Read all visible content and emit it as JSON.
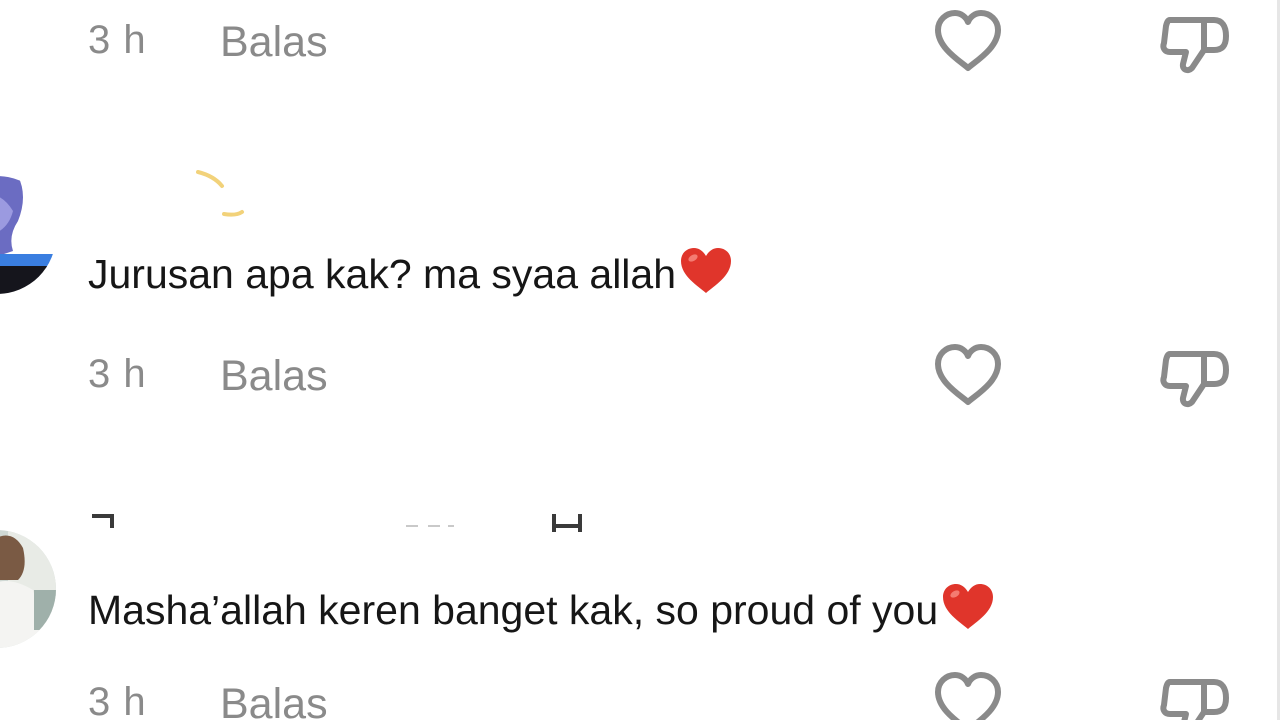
{
  "comments": [
    {
      "text": "",
      "time": "3 h",
      "reply_label": "Balas"
    },
    {
      "text": "Jurusan apa kak? ma syaa allah",
      "time": "3 h",
      "reply_label": "Balas"
    },
    {
      "text": "Masha’allah keren banget kak, so proud of you",
      "time": "3 h",
      "reply_label": "Balas"
    }
  ],
  "icons": {
    "like": "heart-outline-icon",
    "dislike": "thumbs-down-outline-icon",
    "emoji": "red-heart-emoji"
  },
  "colors": {
    "meta_text": "#8a8a8a",
    "comment_text": "#161616",
    "icon_stroke": "#8a8a8a",
    "emoji_heart": "#e0352b"
  }
}
